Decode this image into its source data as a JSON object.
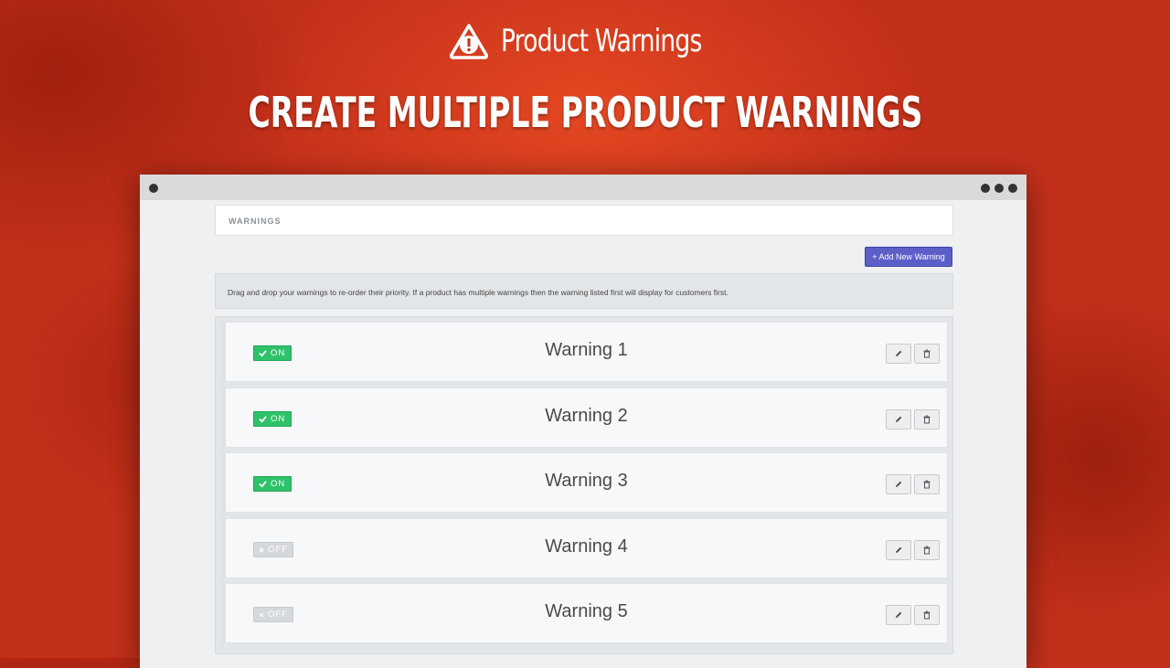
{
  "brand": {
    "name": "Product Warnings",
    "icon": "warning-triangle-icon"
  },
  "headline": "CREATE MULTIPLE PRODUCT WARNINGS",
  "panel": {
    "title": "WARNINGS",
    "add_button": "+ Add New Warning",
    "notice": "Drag and drop your warnings to re-order their priority. If a product has multiple warnings then the warning listed first will display for customers first."
  },
  "warnings": [
    {
      "name": "Warning 1",
      "status": "ON",
      "enabled": true
    },
    {
      "name": "Warning 2",
      "status": "ON",
      "enabled": true
    },
    {
      "name": "Warning 3",
      "status": "ON",
      "enabled": true
    },
    {
      "name": "Warning 4",
      "status": "OFF",
      "enabled": false
    },
    {
      "name": "Warning 5",
      "status": "OFF",
      "enabled": false
    }
  ],
  "icons": {
    "on": "check-icon",
    "off": "x-icon",
    "edit": "pencil-icon",
    "delete": "trash-icon"
  },
  "colors": {
    "background": "#c3301a",
    "on": "#2ec26a",
    "off": "#d6d9dc",
    "button": "#5b5fc7"
  }
}
